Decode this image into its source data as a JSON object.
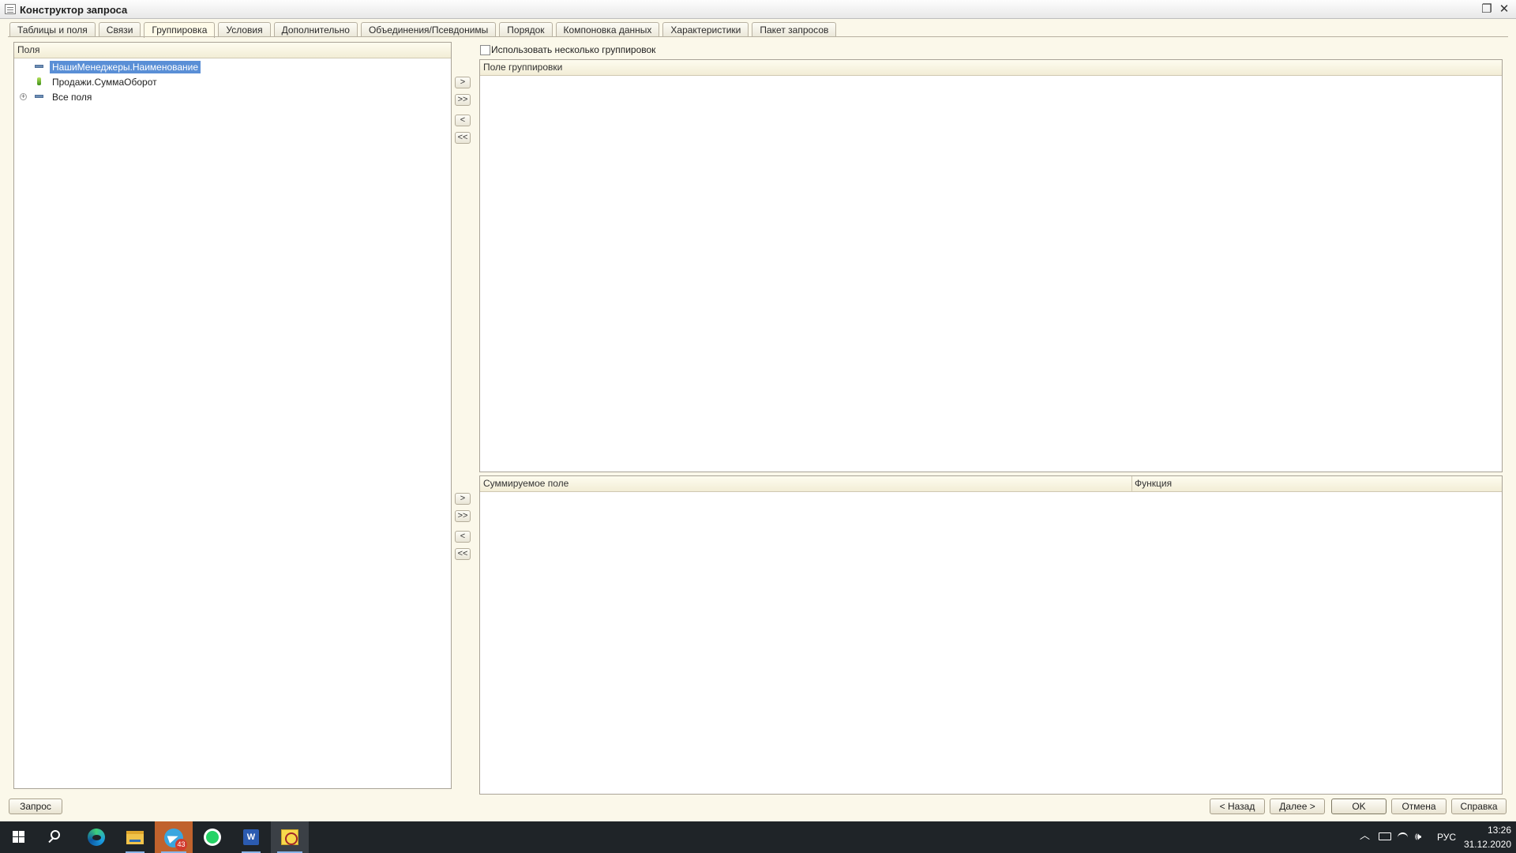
{
  "window": {
    "title": "Конструктор запроса",
    "restore_glyph": "❐",
    "close_glyph": "✕"
  },
  "tabs": [
    {
      "label": "Таблицы и поля",
      "active": false
    },
    {
      "label": "Связи",
      "active": false
    },
    {
      "label": "Группировка",
      "active": true
    },
    {
      "label": "Условия",
      "active": false
    },
    {
      "label": "Дополнительно",
      "active": false
    },
    {
      "label": "Объединения/Псевдонимы",
      "active": false
    },
    {
      "label": "Порядок",
      "active": false
    },
    {
      "label": "Компоновка данных",
      "active": false
    },
    {
      "label": "Характеристики",
      "active": false
    },
    {
      "label": "Пакет запросов",
      "active": false
    }
  ],
  "fields_panel": {
    "header": "Поля",
    "items": [
      {
        "label": "НашиМенеджеры.Наименование",
        "icon": "field-dimension-icon",
        "selected": true,
        "expandable": false
      },
      {
        "label": "Продажи.СуммаОборот",
        "icon": "field-resource-icon",
        "selected": false,
        "expandable": false
      },
      {
        "label": "Все поля",
        "icon": "field-dimension-icon",
        "selected": false,
        "expandable": true,
        "expander_glyph": "+"
      }
    ]
  },
  "move_buttons": {
    "add": ">",
    "add_all": ">>",
    "remove": "<",
    "remove_all": "<<"
  },
  "multiple_groupings": {
    "label": "Использовать несколько группировок",
    "checked": false
  },
  "grouping_grid": {
    "header": "Поле группировки"
  },
  "aggregate_grid": {
    "columns": [
      "Суммируемое поле",
      "Функция"
    ]
  },
  "footer": {
    "query_button": "Запрос",
    "back_button": "< Назад",
    "next_button": "Далее >",
    "ok_button": "OK",
    "cancel_button": "Отмена",
    "help_button": "Справка"
  },
  "taskbar": {
    "telegram_badge": "43",
    "word_letter": "W",
    "language": "РУС",
    "time": "13:26",
    "date": "31.12.2020",
    "tray_up_glyph": "︿",
    "volume_glyph": "🕪"
  }
}
